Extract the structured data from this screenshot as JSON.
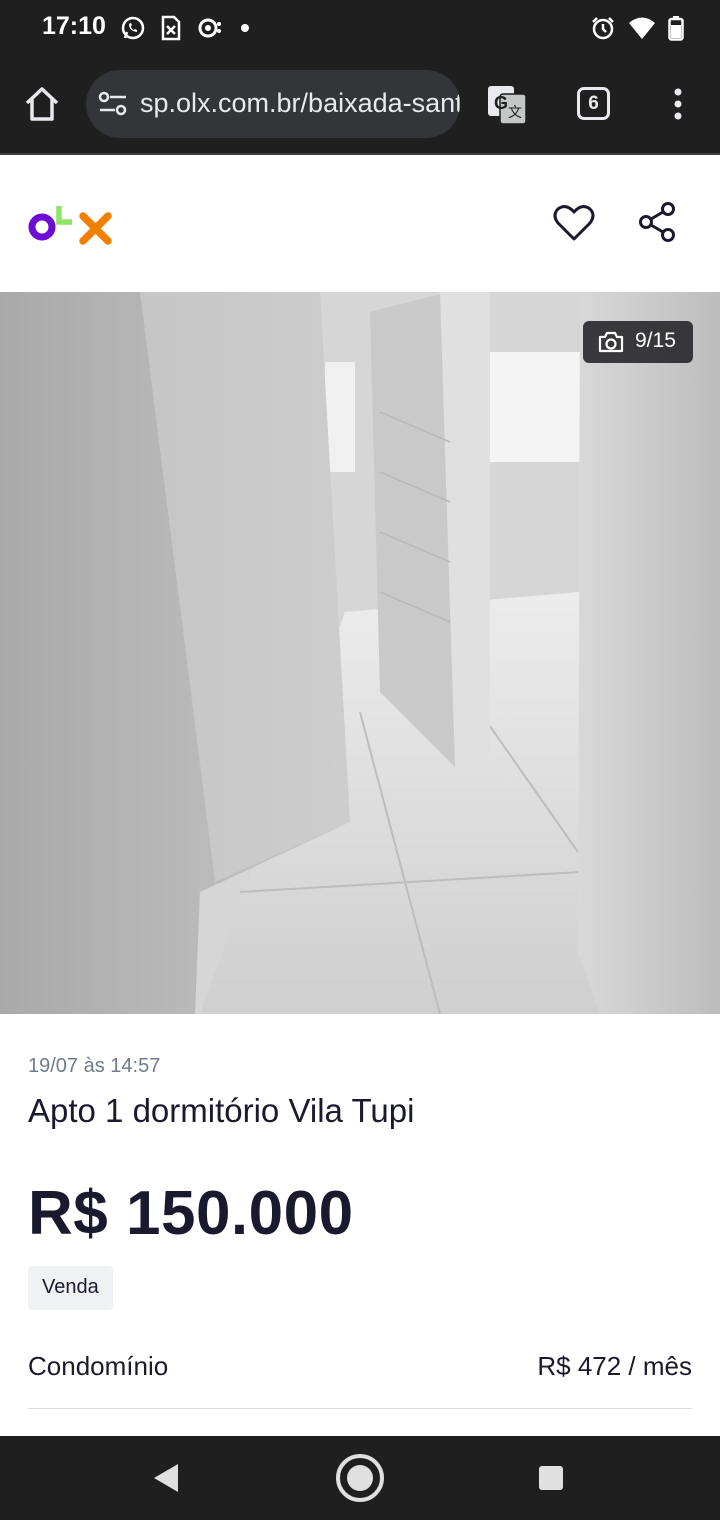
{
  "status_bar": {
    "time": "17:10",
    "left_icons": [
      "whatsapp-icon",
      "sim-notification-icon",
      "sync-icon",
      "dot-icon"
    ],
    "right_icons": [
      "alarm-icon",
      "wifi-icon",
      "battery-icon"
    ]
  },
  "browser": {
    "url": "sp.olx.com.br/baixada-santista",
    "tab_count": "6"
  },
  "header": {
    "logo_text": "OLX",
    "colors": {
      "o": "#6e0ad6",
      "l": "#8ce563",
      "x": "#f28000"
    }
  },
  "photo": {
    "counter": "9/15",
    "description": "Apartment hallway with white walls and glossy tile floor"
  },
  "listing": {
    "date": "19/07 às 14:57",
    "title": "Apto 1 dormitório Vila Tupi",
    "price": "R$ 150.000",
    "badge": "Venda",
    "condo_label": "Condomínio",
    "condo_value": "R$ 472 / mês"
  }
}
